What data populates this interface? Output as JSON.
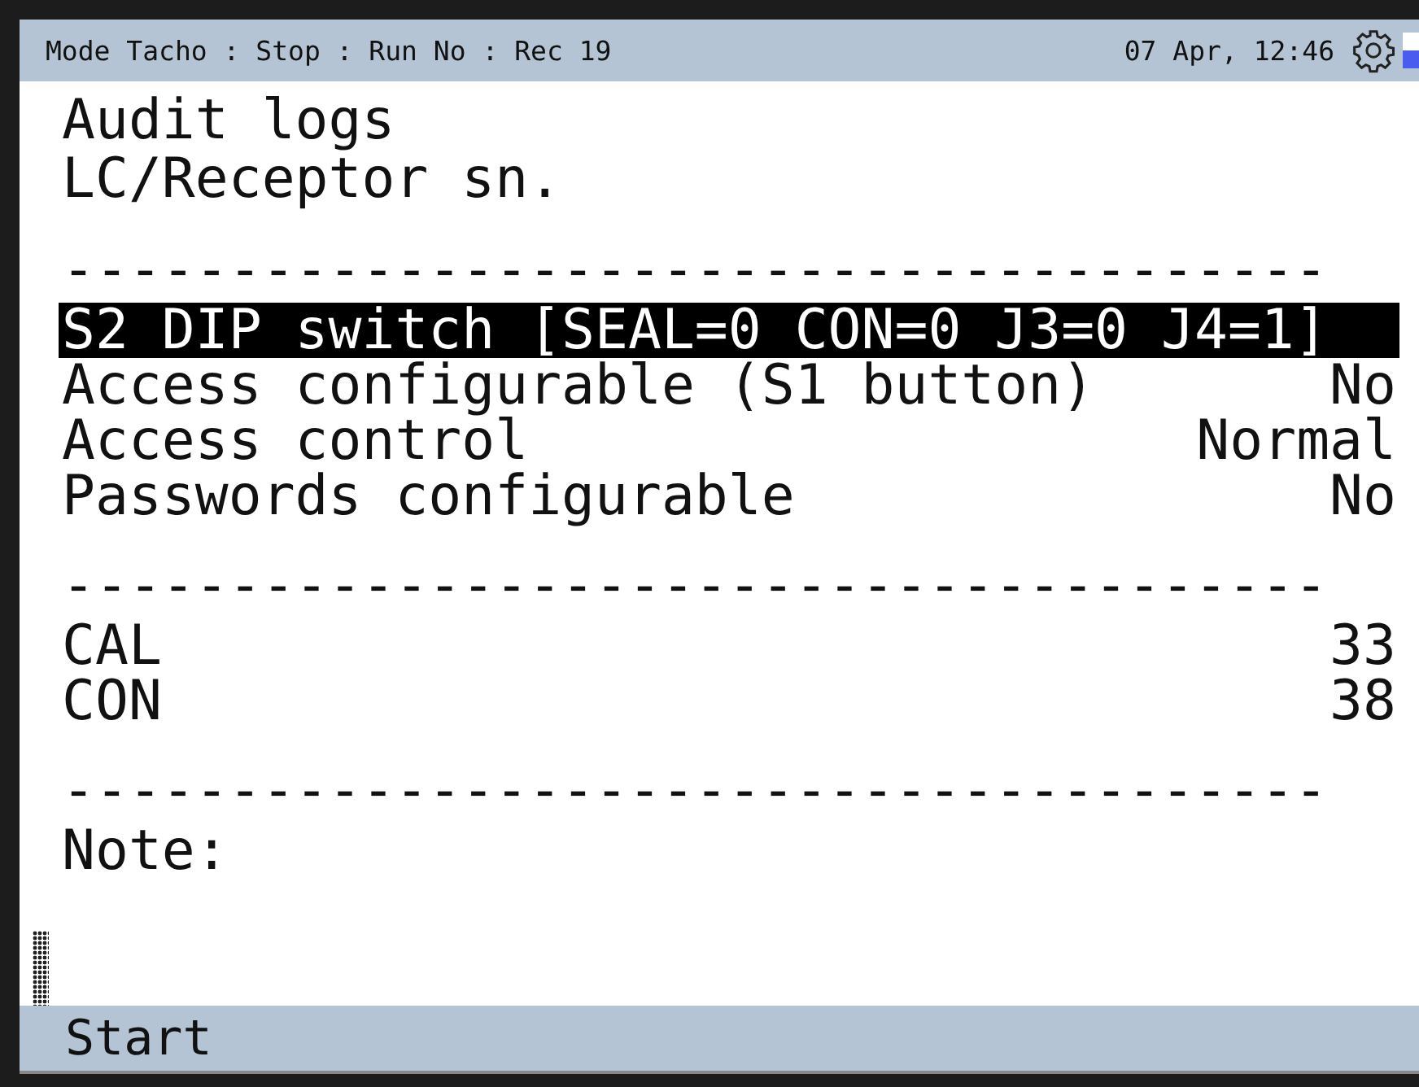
{
  "status_bar": {
    "left": "Mode Tacho : Stop : Run No : Rec 19",
    "datetime": "07 Apr, 12:46"
  },
  "title": "Audit logs",
  "subtitle": "LC/Receptor sn.",
  "rows": [
    {
      "kind": "separator",
      "label": "--------------------------------------"
    },
    {
      "kind": "item",
      "label": "S2 DIP switch [SEAL=0 CON=0 J3=0 J4=1]",
      "selected": true
    },
    {
      "kind": "item",
      "label": "Access configurable (S1 button)",
      "value": "No",
      "selected": false
    },
    {
      "kind": "item",
      "label": "Access control",
      "value": "Normal",
      "selected": false
    },
    {
      "kind": "item",
      "label": "Passwords configurable",
      "value": "No",
      "selected": false
    },
    {
      "kind": "separator",
      "label": "--------------------------------------"
    },
    {
      "kind": "item",
      "label": "CAL",
      "value": "33",
      "selected": false
    },
    {
      "kind": "item",
      "label": "CON",
      "value": "38",
      "selected": false
    },
    {
      "kind": "separator",
      "label": "--------------------------------------"
    },
    {
      "kind": "item",
      "label": "Note:",
      "selected": false
    }
  ],
  "softkeys": [
    "Start"
  ]
}
